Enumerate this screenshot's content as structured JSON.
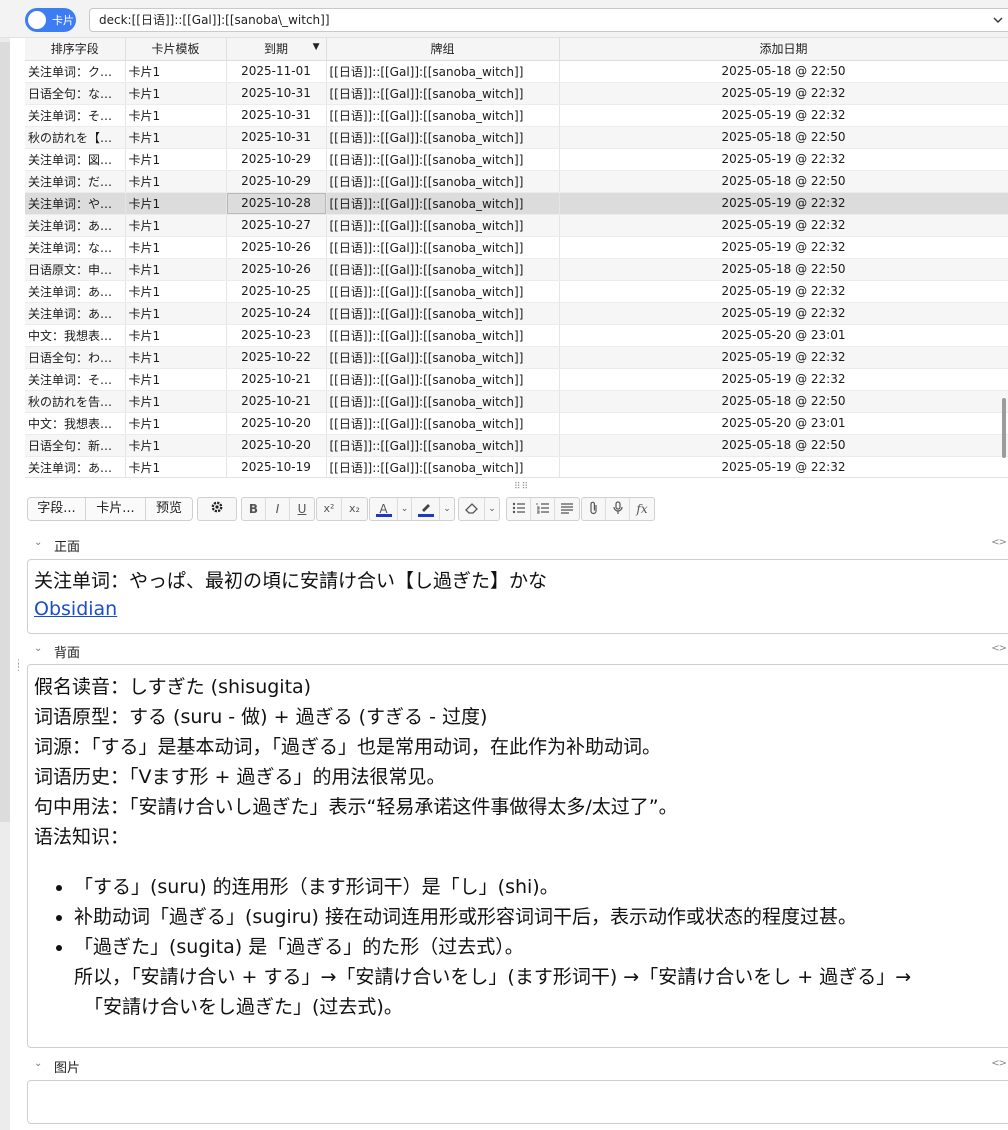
{
  "topbar": {
    "toggle_label": "卡片",
    "search_query": "deck:[[日语]]::[[Gal]]:[[sanoba\\_witch]]",
    "dropdown_icon": "chevron-down-icon"
  },
  "table": {
    "columns": [
      "排序字段",
      "卡片模板",
      "到期",
      "牌组",
      "添加日期"
    ],
    "sort_indicator": "▼",
    "rows": [
      {
        "sort": "关注单词：ク…",
        "template": "卡片1",
        "due": "2025-11-01",
        "deck": "[[日语]]::[[Gal]]:[[sanoba_witch]]",
        "added": "2025-05-18 @ 22:50"
      },
      {
        "sort": "日语全句：な…",
        "template": "卡片1",
        "due": "2025-10-31",
        "deck": "[[日语]]::[[Gal]]:[[sanoba_witch]]",
        "added": "2025-05-19 @ 22:32"
      },
      {
        "sort": "关注单词：そ…",
        "template": "卡片1",
        "due": "2025-10-31",
        "deck": "[[日语]]::[[Gal]]:[[sanoba_witch]]",
        "added": "2025-05-19 @ 22:32"
      },
      {
        "sort": "秋の訪れを【…",
        "template": "卡片1",
        "due": "2025-10-31",
        "deck": "[[日语]]::[[Gal]]:[[sanoba_witch]]",
        "added": "2025-05-18 @ 22:50"
      },
      {
        "sort": "关注单词：図…",
        "template": "卡片1",
        "due": "2025-10-29",
        "deck": "[[日语]]::[[Gal]]:[[sanoba_witch]]",
        "added": "2025-05-19 @ 22:32"
      },
      {
        "sort": "关注单词：だ…",
        "template": "卡片1",
        "due": "2025-10-29",
        "deck": "[[日语]]::[[Gal]]:[[sanoba_witch]]",
        "added": "2025-05-18 @ 22:50"
      },
      {
        "sort": "关注单词：や…",
        "template": "卡片1",
        "due": "2025-10-28",
        "deck": "[[日语]]::[[Gal]]:[[sanoba_witch]]",
        "added": "2025-05-19 @ 22:32",
        "selected": true
      },
      {
        "sort": "关注单词：あ…",
        "template": "卡片1",
        "due": "2025-10-27",
        "deck": "[[日语]]::[[Gal]]:[[sanoba_witch]]",
        "added": "2025-05-19 @ 22:32"
      },
      {
        "sort": "关注单词：な…",
        "template": "卡片1",
        "due": "2025-10-26",
        "deck": "[[日语]]::[[Gal]]:[[sanoba_witch]]",
        "added": "2025-05-19 @ 22:32"
      },
      {
        "sort": "日语原文：申…",
        "template": "卡片1",
        "due": "2025-10-26",
        "deck": "[[日语]]::[[Gal]]:[[sanoba_witch]]",
        "added": "2025-05-18 @ 22:50"
      },
      {
        "sort": "关注单词：あ…",
        "template": "卡片1",
        "due": "2025-10-25",
        "deck": "[[日语]]::[[Gal]]:[[sanoba_witch]]",
        "added": "2025-05-19 @ 22:32"
      },
      {
        "sort": "关注单词：あ…",
        "template": "卡片1",
        "due": "2025-10-24",
        "deck": "[[日语]]::[[Gal]]:[[sanoba_witch]]",
        "added": "2025-05-19 @ 22:32"
      },
      {
        "sort": "中文：我想表…",
        "template": "卡片1",
        "due": "2025-10-23",
        "deck": "[[日语]]::[[Gal]]:[[sanoba_witch]]",
        "added": "2025-05-20 @ 23:01"
      },
      {
        "sort": "日语全句：わ…",
        "template": "卡片1",
        "due": "2025-10-22",
        "deck": "[[日语]]::[[Gal]]:[[sanoba_witch]]",
        "added": "2025-05-19 @ 22:32"
      },
      {
        "sort": "关注单词：そ…",
        "template": "卡片1",
        "due": "2025-10-21",
        "deck": "[[日语]]::[[Gal]]:[[sanoba_witch]]",
        "added": "2025-05-19 @ 22:32"
      },
      {
        "sort": "秋の訪れを告…",
        "template": "卡片1",
        "due": "2025-10-21",
        "deck": "[[日语]]::[[Gal]]:[[sanoba_witch]]",
        "added": "2025-05-18 @ 22:50"
      },
      {
        "sort": "中文：我想表…",
        "template": "卡片1",
        "due": "2025-10-20",
        "deck": "[[日语]]::[[Gal]]:[[sanoba_witch]]",
        "added": "2025-05-20 @ 23:01"
      },
      {
        "sort": "日语全句：新…",
        "template": "卡片1",
        "due": "2025-10-20",
        "deck": "[[日语]]::[[Gal]]:[[sanoba_witch]]",
        "added": "2025-05-18 @ 22:50"
      },
      {
        "sort": "关注单词：あ…",
        "template": "卡片1",
        "due": "2025-10-19",
        "deck": "[[日语]]::[[Gal]]:[[sanoba_witch]]",
        "added": "2025-05-19 @ 22:32"
      }
    ]
  },
  "toolbar": {
    "fields_button": "字段...",
    "cards_button": "卡片...",
    "preview_button": "预览",
    "settings_icon": "gear-icon",
    "bold": "B",
    "italic": "I",
    "underline": "U",
    "superscript": "x²",
    "subscript": "x₂",
    "text_color_glyph": "A",
    "text_color": "#1c39c4",
    "highlight_color": "#1c39c4",
    "eraser_icon": "eraser-icon",
    "unordered_list_icon": "list-bullets-icon",
    "ordered_list_icon": "list-numbers-icon",
    "align_icon": "align-icon",
    "attach_icon": "paperclip-icon",
    "record_icon": "microphone-icon",
    "math_label": "fx"
  },
  "fields": {
    "front": {
      "name": "正面",
      "line1": "关注单词：やっぱ、最初の頃に安請け合い【し過ぎた】かな",
      "link": "Obsidian"
    },
    "back": {
      "name": "背面",
      "lines": [
        "假名读音：しすぎた (shisugita)",
        "词语原型：する (suru - 做) + 過ぎる (すぎる - 过度)",
        "词源：「する」是基本动词，「過ぎる」也是常用动词，在此作为补助动词。",
        "词语历史：「Vます形 + 過ぎる」的用法很常见。",
        "句中用法：「安請け合いし過ぎた」表示“轻易承诺这件事做得太多/太过了”。",
        "语法知识："
      ],
      "bullets": [
        "「する」(suru) 的连用形（ます形词干）是「し」(shi)。",
        "补助动词「過ぎる」(sugiru) 接在动词连用形或形容词词干后，表示动作或状态的程度过甚。",
        "「過ぎた」(sugita) 是「過ぎる」的た形（过去式）。"
      ],
      "continuation_1": "所以，「安請け合い + する」→「安請け合いをし」(ます形词干) →「安請け合いをし + 過ぎる」→",
      "continuation_2": "「安請け合いをし過ぎた」(过去式)。"
    },
    "image": {
      "name": "图片"
    }
  }
}
